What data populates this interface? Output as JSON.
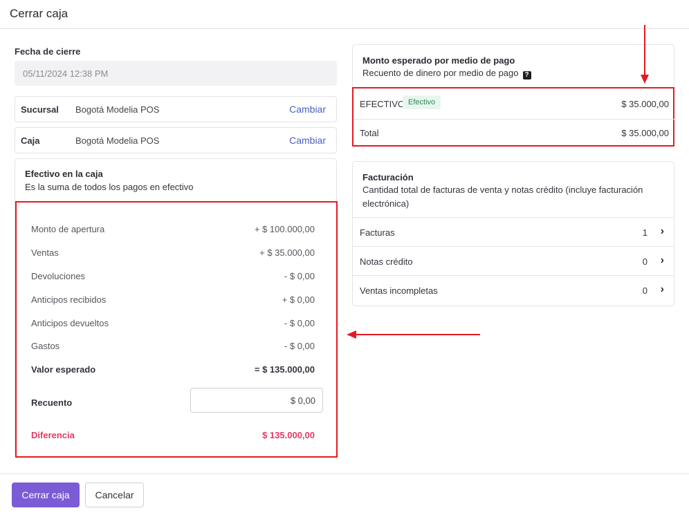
{
  "header": {
    "title": "Cerrar caja"
  },
  "closing_date": {
    "label": "Fecha de cierre",
    "value": "05/11/2024 12:38 PM"
  },
  "branch": {
    "label": "Sucursal",
    "value": "Bogotá Modelia POS",
    "action": "Cambiar"
  },
  "register": {
    "label": "Caja",
    "value": "Bogotá Modelia POS",
    "action": "Cambiar"
  },
  "cash_card": {
    "title": "Efectivo en la caja",
    "subtitle": "Es la suma de todos los pagos en efectivo",
    "lines": [
      {
        "label": "Monto de apertura",
        "amount": "+ $ 100.000,00"
      },
      {
        "label": "Ventas",
        "amount": "+ $ 35.000,00"
      },
      {
        "label": "Devoluciones",
        "amount": "- $ 0,00"
      },
      {
        "label": "Anticipos recibidos",
        "amount": "+ $ 0,00"
      },
      {
        "label": "Anticipos devueltos",
        "amount": "- $ 0,00"
      },
      {
        "label": "Gastos",
        "amount": "- $ 0,00"
      }
    ],
    "expected": {
      "label": "Valor esperado",
      "amount": "= $ 135.000,00"
    },
    "count": {
      "label": "Recuento",
      "value": "$ 0,00"
    },
    "difference": {
      "label": "Diferencia",
      "amount": "$ 135.000,00"
    }
  },
  "payment_card": {
    "title": "Monto esperado por medio de pago",
    "subtitle": "Recuento de dinero por medio de pago",
    "help_icon": "?",
    "method": {
      "label": "EFECTIVO",
      "badge": "Efectivo",
      "amount": "$ 35.000,00"
    },
    "total": {
      "label": "Total",
      "amount": "$ 35.000,00"
    }
  },
  "billing_card": {
    "title": "Facturación",
    "subtitle": "Cantidad total de facturas de venta y notas crédito (incluye facturación electrónica)",
    "rows": [
      {
        "label": "Facturas",
        "count": "1"
      },
      {
        "label": "Notas crédito",
        "count": "0"
      },
      {
        "label": "Ventas incompletas",
        "count": "0"
      }
    ]
  },
  "footer": {
    "primary": "Cerrar caja",
    "secondary": "Cancelar"
  },
  "colors": {
    "accent": "#7b5bd6",
    "annotation": "#e31a23",
    "difference": "#e33b62",
    "link": "#4a5fc1"
  }
}
